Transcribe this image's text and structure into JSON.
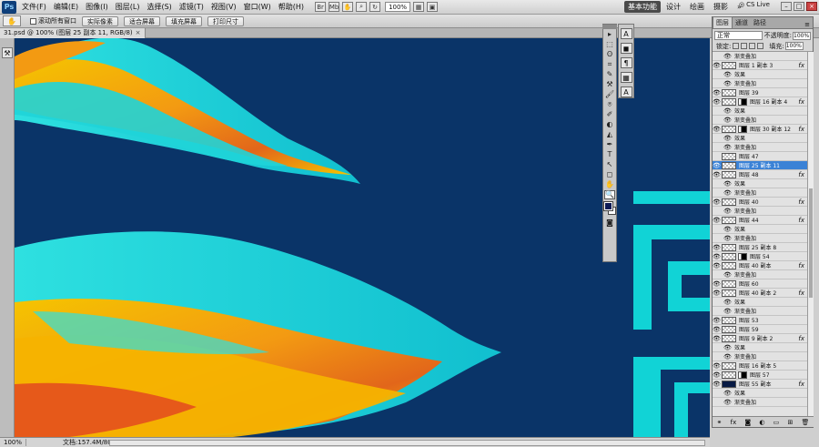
{
  "menubar": {
    "logo": "Ps",
    "items": [
      "文件(F)",
      "编辑(E)",
      "图像(I)",
      "图层(L)",
      "选择(S)",
      "滤镜(T)",
      "视图(V)",
      "窗口(W)",
      "帮助(H)"
    ],
    "zoom": "100%",
    "workspaces": [
      "基本功能",
      "设计",
      "绘画",
      "摄影"
    ],
    "more": "»",
    "cslive": "CS Live"
  },
  "options": {
    "scroll_all": "滚动所有窗口",
    "buttons": [
      "实际像素",
      "适合屏幕",
      "填充屏幕",
      "打印尺寸"
    ]
  },
  "document": {
    "tab_title": "31.psd @ 100% (图层 25 副本 11, RGB/8)",
    "close": "×"
  },
  "status": {
    "zoom": "100%",
    "doc_info": "文档:157.4M/804.4M",
    "arrow": "▸"
  },
  "toolbox": {
    "tools": [
      "▸",
      "⬚",
      "ʘ",
      "⌗",
      "✎",
      "⚒",
      "🖌",
      "⍟",
      "✐",
      "◐",
      "◭",
      "✒",
      "T",
      "↖",
      "◻",
      "✋",
      "🔍"
    ]
  },
  "dock": {
    "icons": [
      "A",
      "◼",
      "¶",
      "▦",
      "A"
    ]
  },
  "layers": {
    "tabs": [
      "图层",
      "通道",
      "路径"
    ],
    "blend_mode": "正常",
    "opacity_label": "不透明度:",
    "opacity": "100%",
    "lock_label": "锁定:",
    "fill_label": "填充:",
    "fill": "100%",
    "rows": [
      {
        "type": "sub",
        "name": "渐变叠加"
      },
      {
        "type": "layer",
        "name": "图层 1 副本 3",
        "fx": "fx",
        "mask": false,
        "eye": true
      },
      {
        "type": "sub",
        "name": "效果"
      },
      {
        "type": "sub",
        "name": "渐变叠加"
      },
      {
        "type": "layer",
        "name": "图层 39",
        "fx": "",
        "mask": false,
        "eye": true
      },
      {
        "type": "layer",
        "name": "图层 16 副本 4",
        "fx": "fx",
        "mask": true,
        "eye": true
      },
      {
        "type": "sub",
        "name": "效果"
      },
      {
        "type": "sub",
        "name": "渐变叠加"
      },
      {
        "type": "layer",
        "name": "图层 30 副本 12",
        "fx": "fx",
        "mask": true,
        "eye": true
      },
      {
        "type": "sub",
        "name": "效果"
      },
      {
        "type": "sub",
        "name": "渐变叠加"
      },
      {
        "type": "layer",
        "name": "图层 47",
        "fx": "",
        "mask": false,
        "eye": false
      },
      {
        "type": "layer",
        "name": "图层 25 副本 11",
        "fx": "",
        "mask": false,
        "eye": true,
        "selected": true
      },
      {
        "type": "layer",
        "name": "图层 48",
        "fx": "fx",
        "mask": false,
        "eye": true
      },
      {
        "type": "sub",
        "name": "效果"
      },
      {
        "type": "sub",
        "name": "渐变叠加"
      },
      {
        "type": "layer",
        "name": "图层 40",
        "fx": "fx",
        "mask": false,
        "eye": true
      },
      {
        "type": "sub",
        "name": "渐变叠加"
      },
      {
        "type": "layer",
        "name": "图层 44",
        "fx": "fx",
        "mask": false,
        "eye": true
      },
      {
        "type": "sub",
        "name": "效果"
      },
      {
        "type": "sub",
        "name": "渐变叠加"
      },
      {
        "type": "layer",
        "name": "图层 25 副本 8",
        "fx": "",
        "mask": false,
        "eye": true
      },
      {
        "type": "layer",
        "name": "图层 54",
        "fx": "",
        "mask": true,
        "eye": true
      },
      {
        "type": "layer",
        "name": "图层 40 副本",
        "fx": "fx",
        "mask": false,
        "eye": true
      },
      {
        "type": "sub",
        "name": "渐变叠加"
      },
      {
        "type": "layer",
        "name": "图层 60",
        "fx": "",
        "mask": false,
        "eye": true
      },
      {
        "type": "layer",
        "name": "图层 40 副本 2",
        "fx": "fx",
        "mask": false,
        "eye": true
      },
      {
        "type": "sub",
        "name": "效果"
      },
      {
        "type": "sub",
        "name": "渐变叠加"
      },
      {
        "type": "layer",
        "name": "图层 53",
        "fx": "",
        "mask": false,
        "eye": true
      },
      {
        "type": "layer",
        "name": "图层 59",
        "fx": "",
        "mask": false,
        "eye": true
      },
      {
        "type": "layer",
        "name": "图层 9 副本 2",
        "fx": "fx",
        "mask": false,
        "eye": true
      },
      {
        "type": "sub",
        "name": "效果"
      },
      {
        "type": "sub",
        "name": "渐变叠加"
      },
      {
        "type": "layer",
        "name": "图层 16 副本 5",
        "fx": "",
        "mask": false,
        "eye": true
      },
      {
        "type": "layer",
        "name": "图层 57",
        "fx": "",
        "mask": true,
        "eye": true
      },
      {
        "type": "layer",
        "name": "图层 55 副本",
        "fx": "fx",
        "mask": false,
        "eye": true,
        "dark": true
      },
      {
        "type": "sub",
        "name": "效果"
      },
      {
        "type": "sub",
        "name": "渐变叠加"
      }
    ],
    "footer": [
      "⚭",
      "fx",
      "◙",
      "◐",
      "▭",
      "⊞",
      "🗑"
    ]
  },
  "colors": {
    "canvas_bg": "#0a3468",
    "cyan": "#11d3d6",
    "orange": "#f39a12",
    "yellow": "#f5c400",
    "selection": "#3b82d6"
  }
}
